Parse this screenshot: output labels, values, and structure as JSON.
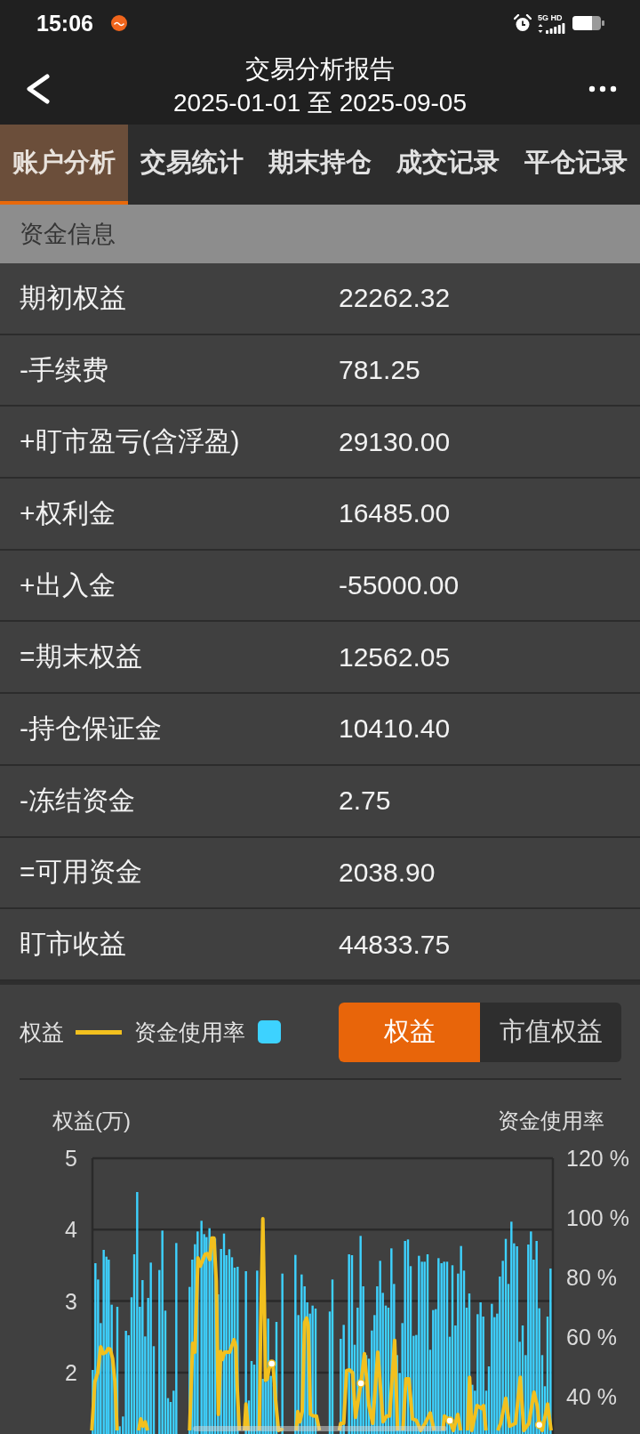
{
  "status_bar": {
    "time": "15:06",
    "network": "5G HD"
  },
  "header": {
    "title": "交易分析报告",
    "subtitle": "2025-01-01 至 2025-09-05"
  },
  "tabs": [
    {
      "label": "账户分析",
      "selected": true
    },
    {
      "label": "交易统计",
      "selected": false
    },
    {
      "label": "期末持仓",
      "selected": false
    },
    {
      "label": "成交记录",
      "selected": false
    },
    {
      "label": "平仓记录",
      "selected": false
    }
  ],
  "funds": {
    "title": "资金信息",
    "rows": [
      {
        "label": "期初权益",
        "value": "22262.32"
      },
      {
        "label": "-手续费",
        "value": "781.25"
      },
      {
        "label": "+盯市盈亏(含浮盈)",
        "value": "29130.00"
      },
      {
        "label": "+权利金",
        "value": "16485.00"
      },
      {
        "label": "+出入金",
        "value": "-55000.00"
      },
      {
        "label": "=期末权益",
        "value": "12562.05"
      },
      {
        "label": "-持仓保证金",
        "value": "10410.40"
      },
      {
        "label": "-冻结资金",
        "value": "2.75"
      },
      {
        "label": "=可用资金",
        "value": "2038.90"
      },
      {
        "label": "盯市收益",
        "value": "44833.75"
      }
    ]
  },
  "chart": {
    "legend": [
      {
        "label": "权益",
        "kind": "line",
        "color": "#f2c01e"
      },
      {
        "label": "资金使用率",
        "kind": "swatch",
        "color": "#3dd2ff"
      }
    ],
    "view_toggle": [
      {
        "label": "权益",
        "selected": true
      },
      {
        "label": "市值权益",
        "selected": false
      }
    ],
    "left_axis_title": "权益(万)",
    "right_axis_title": "资金使用率",
    "left_ticks": [
      "5",
      "4",
      "3",
      "2"
    ],
    "right_ticks": [
      "120 %",
      "100 %",
      "80 %",
      "60 %",
      "40 %"
    ]
  }
}
